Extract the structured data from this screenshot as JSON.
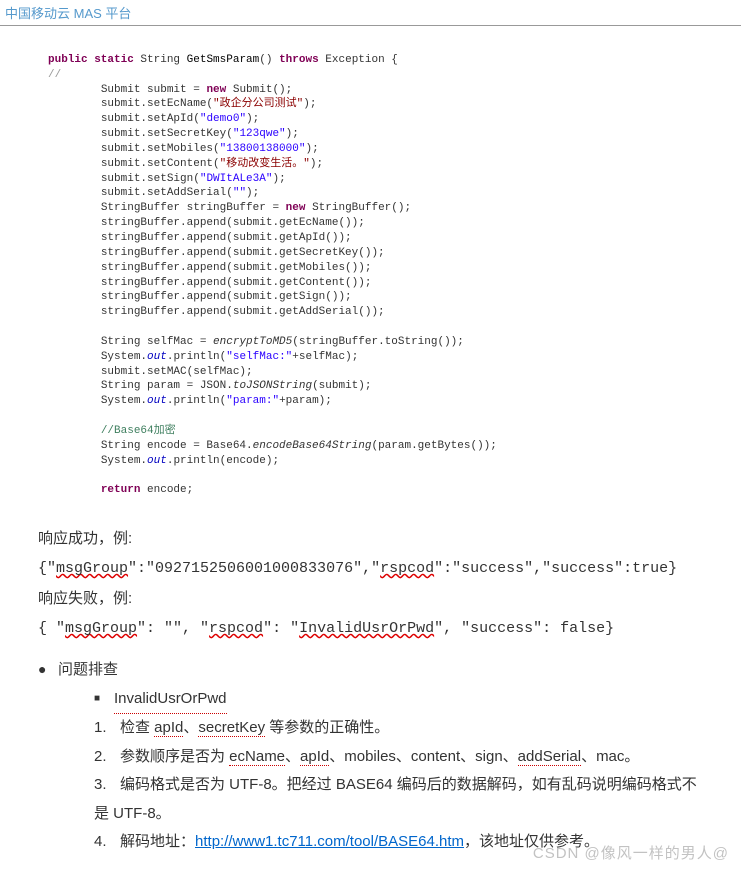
{
  "header": "中国移动云 MAS 平台",
  "code": {
    "line1_a": "public static",
    "line1_b": " String ",
    "line1_c": "GetSmsParam",
    "line1_d": "() ",
    "line1_e": "throws",
    "line1_f": " Exception {",
    "prefix": "//",
    "l2a": "Submit submit = ",
    "l2b": "new",
    "l2c": " Submit();",
    "l3a": "submit.setEcName(",
    "l3s": "\"政企分公司测试\"",
    "l3b": ");",
    "l4a": "submit.setApId(",
    "l4s": "\"demo0\"",
    "l4b": ");",
    "l5a": "submit.setSecretKey(",
    "l5s": "\"123qwe\"",
    "l5b": ");",
    "l6a": "submit.setMobiles(",
    "l6s": "\"13800138000\"",
    "l6b": ");",
    "l7a": "submit.setContent(",
    "l7s": "\"移动改变生活。\"",
    "l7b": ");",
    "l8a": "submit.setSign(",
    "l8s": "\"DWItALe3A\"",
    "l8b": ");",
    "l9": "submit.setAddSerial(",
    "l9s": "\"\"",
    "l9b": ");",
    "l10a": "StringBuffer stringBuffer = ",
    "l10b": "new",
    "l10c": " StringBuffer();",
    "l11": "stringBuffer.append(submit.getEcName());",
    "l12": "stringBuffer.append(submit.getApId());",
    "l13": "stringBuffer.append(submit.getSecretKey());",
    "l14": "stringBuffer.append(submit.getMobiles());",
    "l15": "stringBuffer.append(submit.getContent());",
    "l16": "stringBuffer.append(submit.getSign());",
    "l17": "stringBuffer.append(submit.getAddSerial());",
    "l18a": "String selfMac = ",
    "l18b": "encryptToMD5",
    "l18c": "(stringBuffer.toString());",
    "l19a": "System.",
    "l19b": "out",
    "l19c": ".println(",
    "l19s": "\"selfMac:\"",
    "l19d": "+selfMac);",
    "l20": "submit.setMAC(selfMac);",
    "l21a": "String param = JSON.",
    "l21b": "toJSONString",
    "l21c": "(submit);",
    "l22a": "System.",
    "l22b": "out",
    "l22c": ".println(",
    "l22s": "\"param:\"",
    "l22d": "+param);",
    "l23": "//Base64加密",
    "l24a": "String encode = Base64.",
    "l24b": "encodeBase64String",
    "l24c": "(param.getBytes());",
    "l25a": "System.",
    "l25b": "out",
    "l25c": ".println(encode);",
    "l26a": "return",
    "l26b": " encode;"
  },
  "response": {
    "success_label": "响应成功，例:",
    "success_body_a": "{\"",
    "success_body_b": "msgGroup",
    "success_body_c": "\":\"0927152506001000833076\",\"",
    "success_body_d": "rspcod",
    "success_body_e": "\":\"success\",\"success\":true}",
    "fail_label": "响应失败，例:",
    "fail_a": "{ \"",
    "fail_b": "msgGroup",
    "fail_c": "\": \"\", \"",
    "fail_d": "rspcod",
    "fail_e": "\": \"",
    "fail_f": "InvalidUsrOrPwd",
    "fail_g": "\", \"success\": false}"
  },
  "troubleshoot": {
    "title": "问题排查",
    "sub_title": "InvalidUsrOrPwd",
    "items": [
      {
        "n": "1.",
        "a": "检查 ",
        "b": "apId",
        "c": "、",
        "d": "secretKey",
        "e": " 等参数的正确性。"
      },
      {
        "n": "2.",
        "a": "参数顺序是否为 ",
        "b": "ecName",
        "c": "、",
        "d": "apId",
        "e": "、mobiles、content、sign、",
        "f": "addSerial",
        "g": "、mac。"
      },
      {
        "n": "3.",
        "a": "编码格式是否为 UTF-8。把经过 BASE64 编码后的数据解码，如有乱码说明编码格式不是 UTF-8。"
      },
      {
        "n": "4.",
        "a": "解码地址：",
        "link": "http://www1.tc711.com/tool/BASE64.htm",
        "b": "，该地址仅供参考。"
      }
    ]
  },
  "watermark": "CSDN @像风一样的男人@"
}
